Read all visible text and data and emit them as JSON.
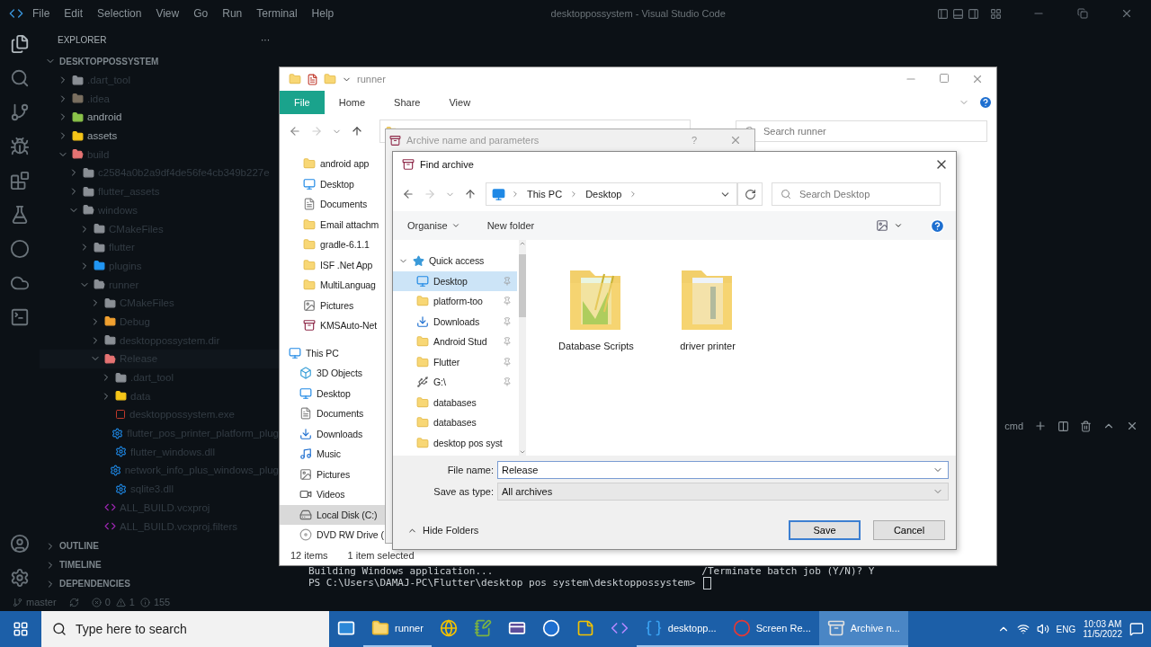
{
  "vscode": {
    "menu": [
      "File",
      "Edit",
      "Selection",
      "View",
      "Go",
      "Run",
      "Terminal",
      "Help"
    ],
    "title": "desktoppossystem - Visual Studio Code",
    "explorer": {
      "title": "EXPLORER",
      "more": "···",
      "root": {
        "label": "DESKTOPPOSSYSTEM",
        "expanded": true
      },
      "tree": [
        {
          "label": ".dart_tool",
          "kind": "folder",
          "color": "#8a8f95",
          "ignored": true,
          "expanded": false
        },
        {
          "label": ".idea",
          "kind": "folder",
          "color": "#7a6f60",
          "ignored": true,
          "expanded": false
        },
        {
          "label": "android",
          "kind": "folder",
          "color": "#8bc34a",
          "ignored": false,
          "expanded": false
        },
        {
          "label": "assets",
          "kind": "folder",
          "color": "#f5c518",
          "ignored": false,
          "expanded": false
        },
        {
          "label": "build",
          "kind": "folder",
          "color": "#e57373",
          "ignored": true,
          "expanded": true,
          "children": [
            {
              "label": "c2584a0b2a9df4de56fe4cb349b227e",
              "kind": "folder",
              "color": "#8a8f95",
              "ignored": true,
              "expanded": false
            },
            {
              "label": "flutter_assets",
              "kind": "folder",
              "color": "#8a8f95",
              "ignored": true,
              "expanded": false
            },
            {
              "label": "windows",
              "kind": "folder",
              "color": "#8a8f95",
              "ignored": true,
              "expanded": true,
              "children": [
                {
                  "label": "CMakeFiles",
                  "kind": "folder",
                  "color": "#8a8f95",
                  "ignored": true,
                  "expanded": false
                },
                {
                  "label": "flutter",
                  "kind": "folder",
                  "color": "#8a8f95",
                  "ignored": true,
                  "expanded": false
                },
                {
                  "label": "plugins",
                  "kind": "folder",
                  "color": "#2196f3",
                  "ignored": true,
                  "expanded": false
                },
                {
                  "label": "runner",
                  "kind": "folder",
                  "color": "#8a8f95",
                  "ignored": true,
                  "expanded": true,
                  "children": [
                    {
                      "label": "CMakeFiles",
                      "kind": "folder",
                      "color": "#8a8f95",
                      "ignored": true,
                      "expanded": false
                    },
                    {
                      "label": "Debug",
                      "kind": "folder",
                      "color": "#f0a030",
                      "ignored": true,
                      "expanded": false
                    },
                    {
                      "label": "desktoppossystem.dir",
                      "kind": "folder",
                      "color": "#8a8f95",
                      "ignored": true,
                      "expanded": false
                    },
                    {
                      "label": "Release",
                      "kind": "folder",
                      "color": "#e57373",
                      "ignored": true,
                      "expanded": true,
                      "selected": true,
                      "children": [
                        {
                          "label": ".dart_tool",
                          "kind": "folder",
                          "color": "#8a8f95",
                          "ignored": true,
                          "expanded": false
                        },
                        {
                          "label": "data",
                          "kind": "folder",
                          "color": "#f5c518",
                          "ignored": true,
                          "expanded": false
                        },
                        {
                          "label": "desktoppossystem.exe",
                          "kind": "exe",
                          "ignored": true
                        },
                        {
                          "label": "flutter_pos_printer_platform_plug",
                          "kind": "dll",
                          "ignored": true
                        },
                        {
                          "label": "flutter_windows.dll",
                          "kind": "dll",
                          "ignored": true
                        },
                        {
                          "label": "network_info_plus_windows_plug",
                          "kind": "dll",
                          "ignored": true
                        },
                        {
                          "label": "sqlite3.dll",
                          "kind": "dll",
                          "ignored": true
                        }
                      ]
                    },
                    {
                      "label": "ALL_BUILD.vcxproj",
                      "kind": "project",
                      "ignored": true
                    },
                    {
                      "label": "ALL_BUILD.vcxproj.filters",
                      "kind": "project",
                      "ignored": true
                    }
                  ]
                }
              ]
            }
          ]
        }
      ],
      "sections": [
        "OUTLINE",
        "TIMELINE",
        "DEPENDENCIES"
      ]
    },
    "terminal": {
      "tab": "cmd",
      "lines": [
        "Building Windows application...",
        "PS C:\\Users\\DAMAJ-PC\\Flutter\\desktop pos system\\desktoppossystem> "
      ],
      "side_line": "/Terminate batch job (Y/N)? Y"
    },
    "status_bar": {
      "branch": "master",
      "errors": "0",
      "warnings": "1",
      "infos": "155"
    }
  },
  "file_explorer": {
    "title": "runner",
    "ribbon_tabs": [
      {
        "label": "File",
        "selected": true
      },
      {
        "label": "Home",
        "selected": false
      },
      {
        "label": "Share",
        "selected": false
      },
      {
        "label": "View",
        "selected": false
      }
    ],
    "search": {
      "placeholder": "Search runner"
    },
    "quick_items": [
      {
        "label": "android app",
        "kind": "folder",
        "selected": false
      },
      {
        "label": "Desktop",
        "kind": "desktop",
        "selected": false
      },
      {
        "label": "Documents",
        "kind": "documents",
        "selected": false
      },
      {
        "label": "Email attachm",
        "kind": "folder",
        "selected": false
      },
      {
        "label": "gradle-6.1.1",
        "kind": "folder",
        "selected": false
      },
      {
        "label": "ISF .Net App",
        "kind": "folder",
        "selected": false
      },
      {
        "label": "MultiLanguag",
        "kind": "folder",
        "selected": false
      },
      {
        "label": "Pictures",
        "kind": "pictures",
        "selected": false
      },
      {
        "label": "KMSAuto-Net",
        "kind": "archive",
        "selected": false
      }
    ],
    "this_pc": {
      "label": "This PC",
      "children": [
        {
          "label": "3D Objects",
          "kind": "objects",
          "selected": false
        },
        {
          "label": "Desktop",
          "kind": "desktop",
          "selected": false
        },
        {
          "label": "Documents",
          "kind": "documents",
          "selected": false
        },
        {
          "label": "Downloads",
          "kind": "downloads",
          "selected": false
        },
        {
          "label": "Music",
          "kind": "music",
          "selected": false
        },
        {
          "label": "Pictures",
          "kind": "pictures",
          "selected": false
        },
        {
          "label": "Videos",
          "kind": "videos",
          "selected": false
        },
        {
          "label": "Local Disk (C:)",
          "kind": "disk",
          "selected": true
        },
        {
          "label": "DVD RW Drive (",
          "kind": "dvd",
          "selected": false
        }
      ]
    },
    "status": [
      "12 items",
      "1 item selected"
    ]
  },
  "archive_dialog": {
    "title": "Archive name and parameters",
    "help": "?"
  },
  "find_dialog": {
    "title": "Find archive",
    "breadcrumb": [
      "This PC",
      "Desktop"
    ],
    "search": {
      "placeholder": "Search Desktop"
    },
    "toolbar": [
      "Organise",
      "New folder"
    ],
    "quick_access": {
      "label": "Quick access",
      "expanded": true,
      "children": [
        {
          "label": "Desktop",
          "kind": "desktop",
          "selected": true,
          "pinned": true
        },
        {
          "label": "platform-too",
          "kind": "folder",
          "selected": false,
          "pinned": true
        },
        {
          "label": "Downloads",
          "kind": "downloads",
          "selected": false,
          "pinned": true
        },
        {
          "label": "Android Stud",
          "kind": "folder",
          "selected": false,
          "pinned": true
        },
        {
          "label": "Flutter",
          "kind": "folder",
          "selected": false,
          "pinned": true
        },
        {
          "label": "G:\\",
          "kind": "drive",
          "selected": false,
          "pinned": true
        },
        {
          "label": "databases",
          "kind": "folder",
          "selected": false,
          "pinned": false
        },
        {
          "label": "databases",
          "kind": "folder",
          "selected": false,
          "pinned": false
        },
        {
          "label": "desktop pos syst",
          "kind": "folder",
          "selected": false,
          "pinned": false
        }
      ]
    },
    "files": [
      {
        "label": "Database Scripts",
        "kind": "green"
      },
      {
        "label": "driver printer",
        "kind": "blue"
      }
    ],
    "file_name": {
      "label": "File name:",
      "value": "Release"
    },
    "save_type": {
      "label": "Save as type:",
      "value": "All archives"
    },
    "hide_folders": "Hide Folders",
    "buttons": [
      {
        "label": "Save",
        "default": true
      },
      {
        "label": "Cancel",
        "default": false
      }
    ]
  },
  "taskbar": {
    "search": {
      "placeholder": "Type here to search"
    },
    "apps": [
      {
        "kind": "mail",
        "selected": false
      },
      {
        "kind": "folder",
        "label": "runner",
        "selected": false
      },
      {
        "kind": "browser",
        "selected": false
      },
      {
        "kind": "notes",
        "selected": false
      },
      {
        "kind": "card",
        "selected": false
      },
      {
        "kind": "word",
        "selected": false
      },
      {
        "kind": "sticky",
        "selected": false
      },
      {
        "kind": "studio",
        "selected": false
      },
      {
        "kind": "code",
        "label": "desktopp...",
        "selected": false
      },
      {
        "kind": "record",
        "label": "Screen Re...",
        "selected": false
      },
      {
        "kind": "archive",
        "label": "Archive n...",
        "selected": true
      }
    ],
    "language": "ENG",
    "time": "10:03 AM",
    "date": "11/5/2022"
  }
}
